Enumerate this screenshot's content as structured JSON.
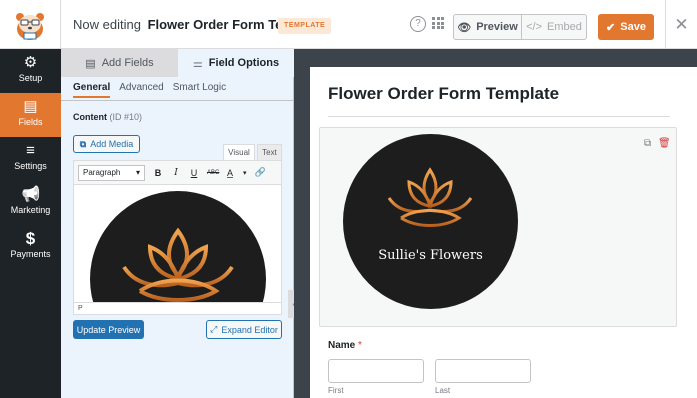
{
  "header": {
    "editing_prefix": "Now editing",
    "form_name": "Flower Order Form Template",
    "badge": "TEMPLATE",
    "help_icon": "?",
    "preview_label": "Preview",
    "embed_label": "Embed",
    "save_label": "Save",
    "close_icon": "✕",
    "accent_color": "#e27730"
  },
  "sidebar": {
    "items": [
      {
        "label": "Setup",
        "icon": "gear-icon",
        "glyph": "⚙"
      },
      {
        "label": "Fields",
        "icon": "fields-icon",
        "glyph": "▤"
      },
      {
        "label": "Settings",
        "icon": "sliders-icon",
        "glyph": "≡"
      },
      {
        "label": "Marketing",
        "icon": "megaphone-icon",
        "glyph": "📢"
      },
      {
        "label": "Payments",
        "icon": "dollar-icon",
        "glyph": "$"
      }
    ],
    "active": "Fields"
  },
  "panel": {
    "tabs": [
      {
        "label": "Add Fields",
        "icon": "list-icon"
      },
      {
        "label": "Field Options",
        "icon": "sliders-icon"
      }
    ],
    "subtabs": [
      "General",
      "Advanced",
      "Smart Logic"
    ],
    "content_label": "Content",
    "content_id": "(ID #10)",
    "add_media": "Add Media",
    "editor_tabs": {
      "visual": "Visual",
      "text": "Text"
    },
    "format_select": "Paragraph",
    "status_path": "P",
    "update_preview": "Update Preview",
    "expand_editor": "Expand Editor"
  },
  "preview": {
    "form_title": "Flower Order Form Template",
    "image_text": "Sullie's Flowers",
    "name_label": "Name",
    "required_mark": "*",
    "first_label": "First",
    "last_label": "Last"
  }
}
